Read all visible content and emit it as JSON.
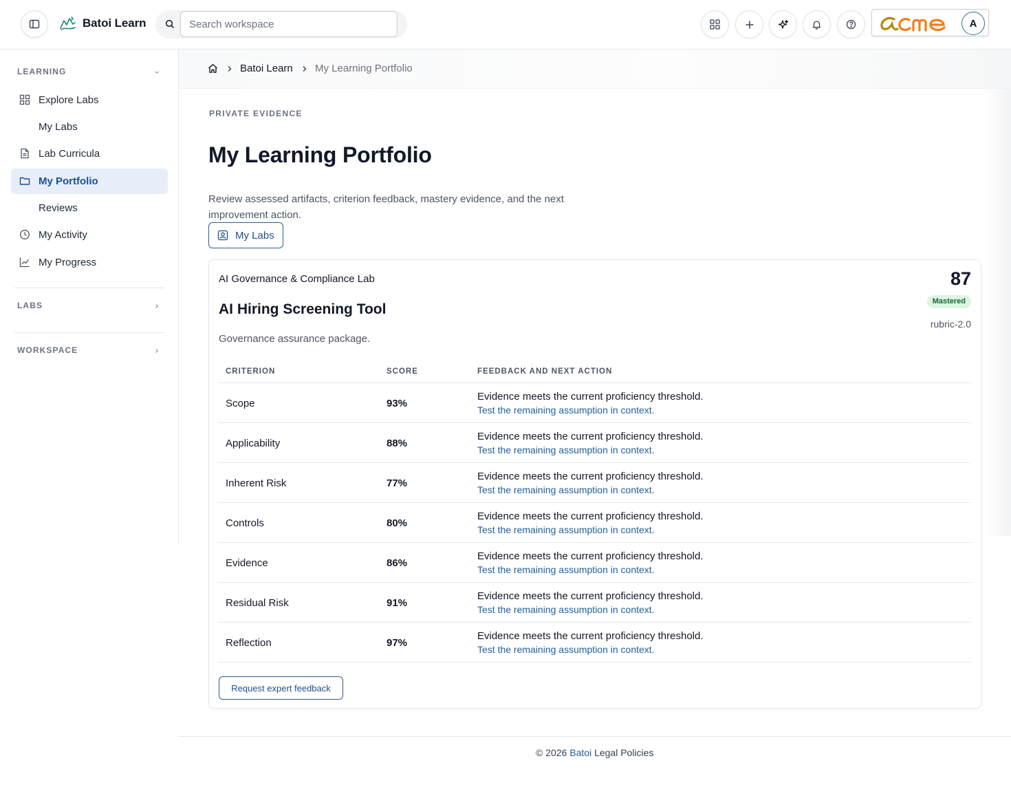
{
  "topbar": {
    "brand": "Batoi Learn",
    "search_placeholder": "Search workspace",
    "avatar_initial": "A",
    "org_logo": "acme"
  },
  "sidebar": {
    "learning_header": "LEARNING",
    "items": [
      {
        "label": "Explore Labs",
        "icon": "grid-icon"
      },
      {
        "label": "My Labs",
        "icon": ""
      },
      {
        "label": "Lab Curricula",
        "icon": "document-icon"
      },
      {
        "label": "My Portfolio",
        "icon": "folder-icon",
        "active": true
      },
      {
        "label": "Reviews",
        "icon": ""
      },
      {
        "label": "My Activity",
        "icon": "clock-icon"
      },
      {
        "label": "My Progress",
        "icon": "chart-line-icon"
      }
    ],
    "labs_header": "LABS",
    "workspace_header": "WORKSPACE"
  },
  "breadcrumb": {
    "items": [
      "Batoi Learn",
      "My Learning Portfolio"
    ]
  },
  "page": {
    "eyebrow": "PRIVATE EVIDENCE",
    "title": "My Learning Portfolio",
    "description": "Review assessed artifacts, criterion feedback, mastery evidence, and the next improvement action.",
    "my_labs_button": "My Labs"
  },
  "card": {
    "lab_name": "AI Governance & Compliance Lab",
    "title": "AI Hiring Screening Tool",
    "subtitle": "Governance assurance package.",
    "score": "87",
    "status_badge": "Mastered",
    "rubric": "rubric-2.0",
    "columns": [
      "CRITERION",
      "SCORE",
      "FEEDBACK AND NEXT ACTION"
    ],
    "rows": [
      {
        "criterion": "Scope",
        "score": "93%",
        "feedback": "Evidence meets the current proficiency threshold.",
        "next": "Test the remaining assumption in context."
      },
      {
        "criterion": "Applicability",
        "score": "88%",
        "feedback": "Evidence meets the current proficiency threshold.",
        "next": "Test the remaining assumption in context."
      },
      {
        "criterion": "Inherent Risk",
        "score": "77%",
        "feedback": "Evidence meets the current proficiency threshold.",
        "next": "Test the remaining assumption in context."
      },
      {
        "criterion": "Controls",
        "score": "80%",
        "feedback": "Evidence meets the current proficiency threshold.",
        "next": "Test the remaining assumption in context."
      },
      {
        "criterion": "Evidence",
        "score": "86%",
        "feedback": "Evidence meets the current proficiency threshold.",
        "next": "Test the remaining assumption in context."
      },
      {
        "criterion": "Residual Risk",
        "score": "91%",
        "feedback": "Evidence meets the current proficiency threshold.",
        "next": "Test the remaining assumption in context."
      },
      {
        "criterion": "Reflection",
        "score": "97%",
        "feedback": "Evidence meets the current proficiency threshold.",
        "next": "Test the remaining assumption in context."
      }
    ],
    "request_button": "Request expert feedback"
  },
  "footer": {
    "copyright": "© 2026",
    "brand_link": "Batoi",
    "policies": "Legal Policies"
  },
  "colors": {
    "accent": "#1d4f91",
    "link": "#1f5f9e",
    "badge_bg": "#dcf5e3",
    "badge_text": "#166534",
    "acme_orange": "#f07d1a",
    "acme_gold": "#b8860b"
  }
}
